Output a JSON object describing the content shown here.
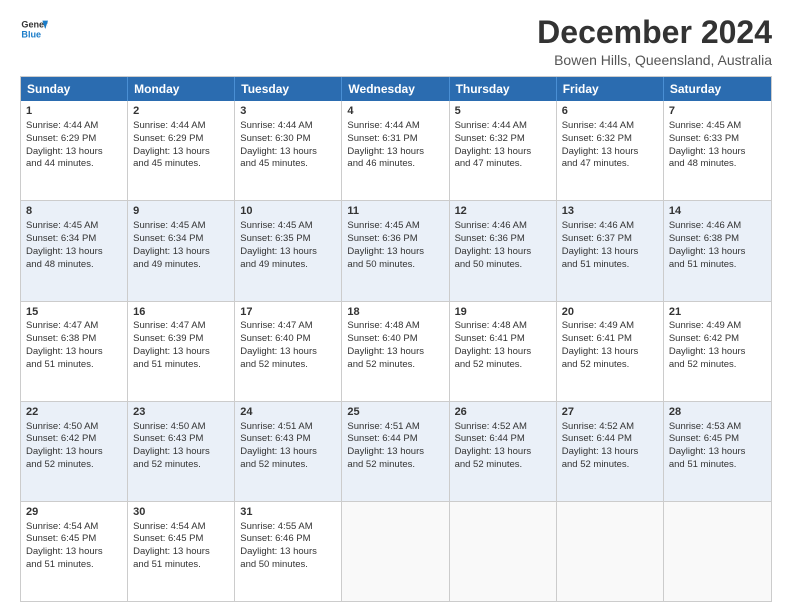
{
  "logo": {
    "line1": "General",
    "line2": "Blue"
  },
  "title": "December 2024",
  "subtitle": "Bowen Hills, Queensland, Australia",
  "header_days": [
    "Sunday",
    "Monday",
    "Tuesday",
    "Wednesday",
    "Thursday",
    "Friday",
    "Saturday"
  ],
  "rows": [
    {
      "alt": false,
      "cells": [
        {
          "day": "1",
          "lines": [
            "Sunrise: 4:44 AM",
            "Sunset: 6:29 PM",
            "Daylight: 13 hours",
            "and 44 minutes."
          ]
        },
        {
          "day": "2",
          "lines": [
            "Sunrise: 4:44 AM",
            "Sunset: 6:29 PM",
            "Daylight: 13 hours",
            "and 45 minutes."
          ]
        },
        {
          "day": "3",
          "lines": [
            "Sunrise: 4:44 AM",
            "Sunset: 6:30 PM",
            "Daylight: 13 hours",
            "and 45 minutes."
          ]
        },
        {
          "day": "4",
          "lines": [
            "Sunrise: 4:44 AM",
            "Sunset: 6:31 PM",
            "Daylight: 13 hours",
            "and 46 minutes."
          ]
        },
        {
          "day": "5",
          "lines": [
            "Sunrise: 4:44 AM",
            "Sunset: 6:32 PM",
            "Daylight: 13 hours",
            "and 47 minutes."
          ]
        },
        {
          "day": "6",
          "lines": [
            "Sunrise: 4:44 AM",
            "Sunset: 6:32 PM",
            "Daylight: 13 hours",
            "and 47 minutes."
          ]
        },
        {
          "day": "7",
          "lines": [
            "Sunrise: 4:45 AM",
            "Sunset: 6:33 PM",
            "Daylight: 13 hours",
            "and 48 minutes."
          ]
        }
      ]
    },
    {
      "alt": true,
      "cells": [
        {
          "day": "8",
          "lines": [
            "Sunrise: 4:45 AM",
            "Sunset: 6:34 PM",
            "Daylight: 13 hours",
            "and 48 minutes."
          ]
        },
        {
          "day": "9",
          "lines": [
            "Sunrise: 4:45 AM",
            "Sunset: 6:34 PM",
            "Daylight: 13 hours",
            "and 49 minutes."
          ]
        },
        {
          "day": "10",
          "lines": [
            "Sunrise: 4:45 AM",
            "Sunset: 6:35 PM",
            "Daylight: 13 hours",
            "and 49 minutes."
          ]
        },
        {
          "day": "11",
          "lines": [
            "Sunrise: 4:45 AM",
            "Sunset: 6:36 PM",
            "Daylight: 13 hours",
            "and 50 minutes."
          ]
        },
        {
          "day": "12",
          "lines": [
            "Sunrise: 4:46 AM",
            "Sunset: 6:36 PM",
            "Daylight: 13 hours",
            "and 50 minutes."
          ]
        },
        {
          "day": "13",
          "lines": [
            "Sunrise: 4:46 AM",
            "Sunset: 6:37 PM",
            "Daylight: 13 hours",
            "and 51 minutes."
          ]
        },
        {
          "day": "14",
          "lines": [
            "Sunrise: 4:46 AM",
            "Sunset: 6:38 PM",
            "Daylight: 13 hours",
            "and 51 minutes."
          ]
        }
      ]
    },
    {
      "alt": false,
      "cells": [
        {
          "day": "15",
          "lines": [
            "Sunrise: 4:47 AM",
            "Sunset: 6:38 PM",
            "Daylight: 13 hours",
            "and 51 minutes."
          ]
        },
        {
          "day": "16",
          "lines": [
            "Sunrise: 4:47 AM",
            "Sunset: 6:39 PM",
            "Daylight: 13 hours",
            "and 51 minutes."
          ]
        },
        {
          "day": "17",
          "lines": [
            "Sunrise: 4:47 AM",
            "Sunset: 6:40 PM",
            "Daylight: 13 hours",
            "and 52 minutes."
          ]
        },
        {
          "day": "18",
          "lines": [
            "Sunrise: 4:48 AM",
            "Sunset: 6:40 PM",
            "Daylight: 13 hours",
            "and 52 minutes."
          ]
        },
        {
          "day": "19",
          "lines": [
            "Sunrise: 4:48 AM",
            "Sunset: 6:41 PM",
            "Daylight: 13 hours",
            "and 52 minutes."
          ]
        },
        {
          "day": "20",
          "lines": [
            "Sunrise: 4:49 AM",
            "Sunset: 6:41 PM",
            "Daylight: 13 hours",
            "and 52 minutes."
          ]
        },
        {
          "day": "21",
          "lines": [
            "Sunrise: 4:49 AM",
            "Sunset: 6:42 PM",
            "Daylight: 13 hours",
            "and 52 minutes."
          ]
        }
      ]
    },
    {
      "alt": true,
      "cells": [
        {
          "day": "22",
          "lines": [
            "Sunrise: 4:50 AM",
            "Sunset: 6:42 PM",
            "Daylight: 13 hours",
            "and 52 minutes."
          ]
        },
        {
          "day": "23",
          "lines": [
            "Sunrise: 4:50 AM",
            "Sunset: 6:43 PM",
            "Daylight: 13 hours",
            "and 52 minutes."
          ]
        },
        {
          "day": "24",
          "lines": [
            "Sunrise: 4:51 AM",
            "Sunset: 6:43 PM",
            "Daylight: 13 hours",
            "and 52 minutes."
          ]
        },
        {
          "day": "25",
          "lines": [
            "Sunrise: 4:51 AM",
            "Sunset: 6:44 PM",
            "Daylight: 13 hours",
            "and 52 minutes."
          ]
        },
        {
          "day": "26",
          "lines": [
            "Sunrise: 4:52 AM",
            "Sunset: 6:44 PM",
            "Daylight: 13 hours",
            "and 52 minutes."
          ]
        },
        {
          "day": "27",
          "lines": [
            "Sunrise: 4:52 AM",
            "Sunset: 6:44 PM",
            "Daylight: 13 hours",
            "and 52 minutes."
          ]
        },
        {
          "day": "28",
          "lines": [
            "Sunrise: 4:53 AM",
            "Sunset: 6:45 PM",
            "Daylight: 13 hours",
            "and 51 minutes."
          ]
        }
      ]
    },
    {
      "alt": false,
      "cells": [
        {
          "day": "29",
          "lines": [
            "Sunrise: 4:54 AM",
            "Sunset: 6:45 PM",
            "Daylight: 13 hours",
            "and 51 minutes."
          ]
        },
        {
          "day": "30",
          "lines": [
            "Sunrise: 4:54 AM",
            "Sunset: 6:45 PM",
            "Daylight: 13 hours",
            "and 51 minutes."
          ]
        },
        {
          "day": "31",
          "lines": [
            "Sunrise: 4:55 AM",
            "Sunset: 6:46 PM",
            "Daylight: 13 hours",
            "and 50 minutes."
          ]
        },
        {
          "day": "",
          "lines": []
        },
        {
          "day": "",
          "lines": []
        },
        {
          "day": "",
          "lines": []
        },
        {
          "day": "",
          "lines": []
        }
      ]
    }
  ]
}
